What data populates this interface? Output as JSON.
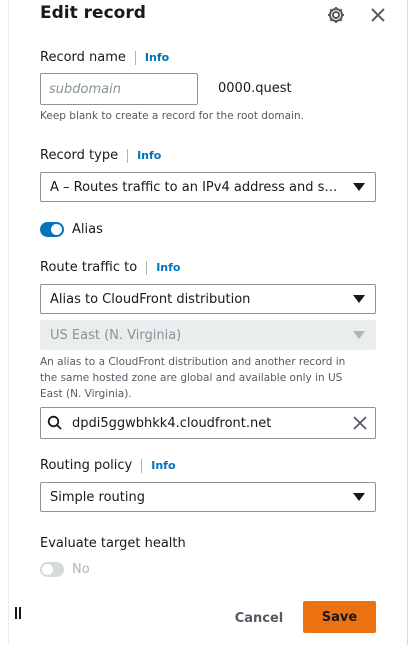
{
  "header": {
    "title": "Edit record"
  },
  "record_name": {
    "label": "Record name",
    "info": "Info",
    "placeholder": "subdomain",
    "suffix": "0000.quest",
    "hint": "Keep blank to create a record for the root domain."
  },
  "record_type": {
    "label": "Record type",
    "info": "Info",
    "value": "A – Routes traffic to an IPv4 address and so…"
  },
  "alias": {
    "label": "Alias",
    "enabled": true
  },
  "route_traffic": {
    "label": "Route traffic to",
    "info": "Info",
    "target_type": "Alias to CloudFront distribution",
    "region": "US East (N. Virginia)",
    "note_line1": "An alias to a CloudFront distribution and another record in",
    "note_line2": "the same hosted zone are global and available only in US",
    "note_line3": "East (N. Virginia).",
    "endpoint": "dpdi5ggwbhkk4.cloudfront.net"
  },
  "routing_policy": {
    "label": "Routing policy",
    "info": "Info",
    "value": "Simple routing"
  },
  "target_health": {
    "label": "Evaluate target health",
    "value": "No",
    "enabled": false
  },
  "footer": {
    "cancel": "Cancel",
    "save": "Save"
  },
  "colors": {
    "accent": "#0073bb",
    "primary_button": "#ec7211",
    "border": "#879596"
  },
  "icons": [
    "gear-icon",
    "close-icon",
    "search-icon",
    "clear-icon",
    "caret-down-icon",
    "resize-handle-icon"
  ]
}
